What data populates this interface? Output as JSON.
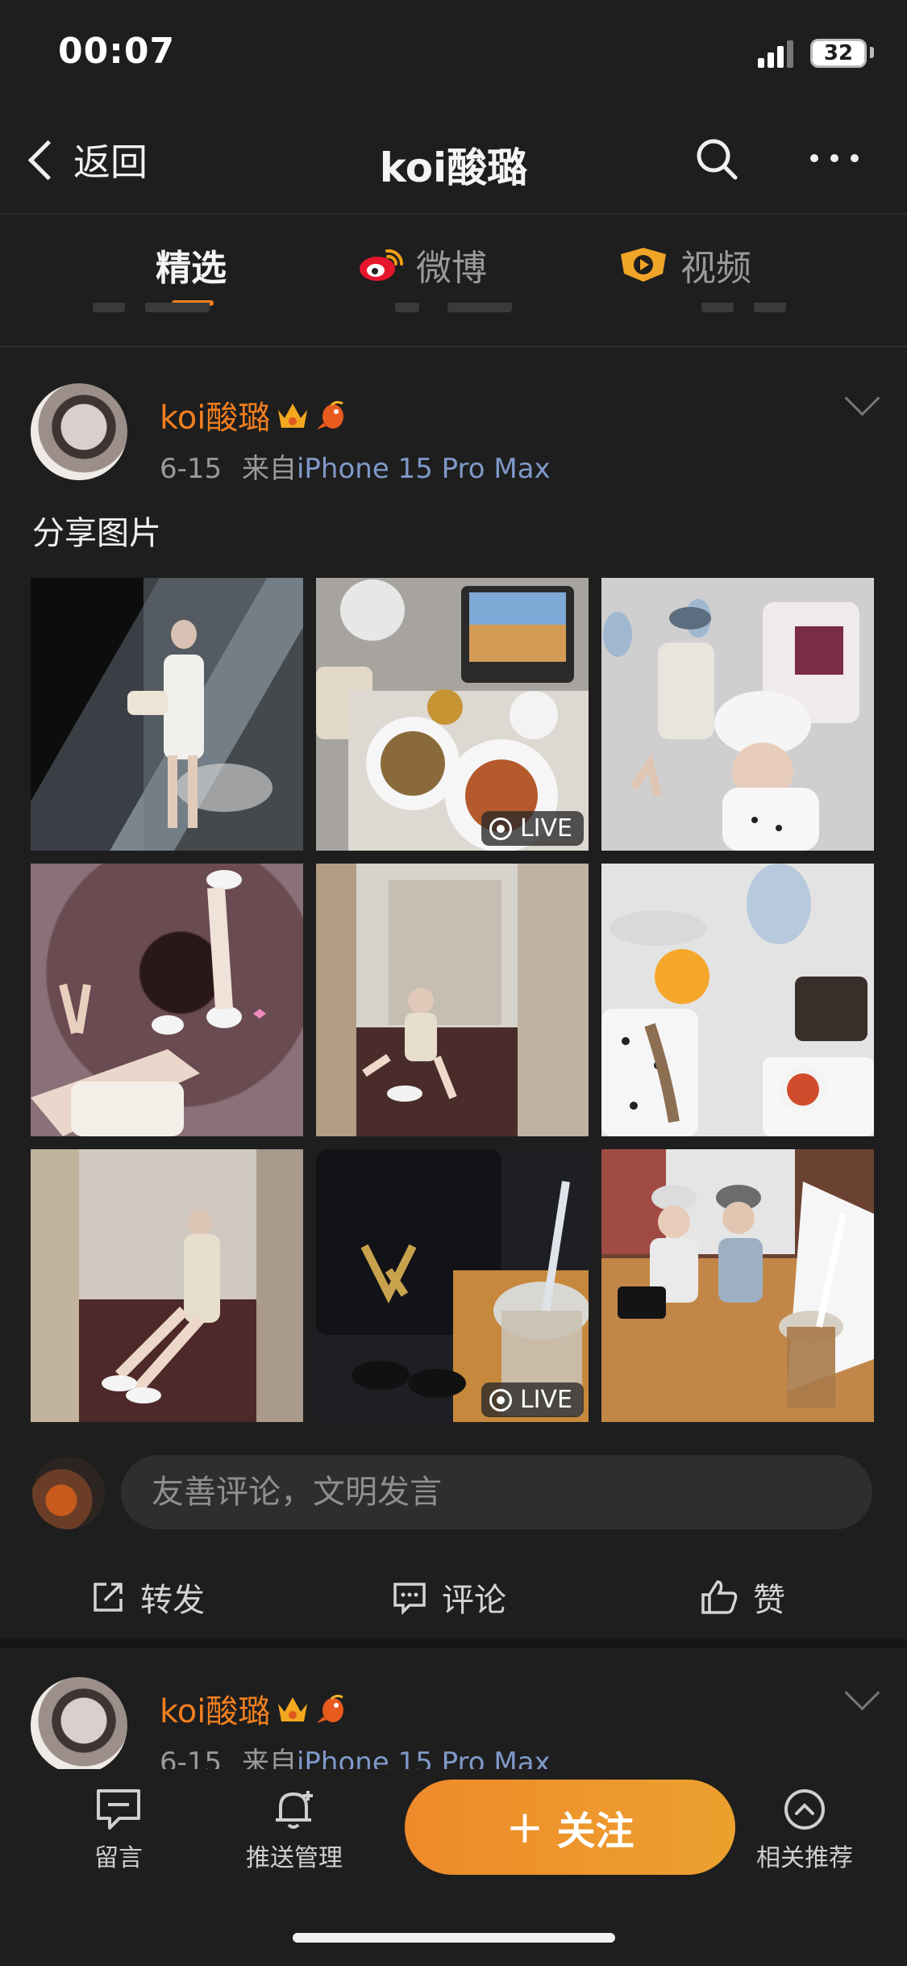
{
  "status": {
    "time": "00:07",
    "battery": "32"
  },
  "nav": {
    "back_label": "返回",
    "title": "koi酸璐"
  },
  "tabs": [
    {
      "label": "精选",
      "icon": ""
    },
    {
      "label": "微博",
      "icon": "weibo-logo-icon"
    },
    {
      "label": "视频",
      "icon": "video-play-icon"
    }
  ],
  "post": {
    "username": "koi酸璐",
    "date": "6-15",
    "source_prefix": "来自",
    "source": "iPhone 15 Pro Max",
    "text": "分享图片",
    "live_label": "LIVE",
    "photos": [
      {
        "desc": "hotel-window",
        "live": false
      },
      {
        "desc": "airline-meal",
        "live": true
      },
      {
        "desc": "airplane-cabin",
        "live": false
      },
      {
        "desc": "floor-selfie",
        "live": false
      },
      {
        "desc": "hallway-sitting",
        "live": false
      },
      {
        "desc": "plane-meal-selfie",
        "live": false
      },
      {
        "desc": "hallway-floor",
        "live": false
      },
      {
        "desc": "bag-drink",
        "live": true
      },
      {
        "desc": "restaurant-friends",
        "live": false
      }
    ]
  },
  "comment": {
    "placeholder": "友善评论，文明发言"
  },
  "actions": {
    "repost": "转发",
    "comment": "评论",
    "like": "赞"
  },
  "next_post": {
    "username": "koi酸璐",
    "date": "6-15",
    "source_prefix": "来自",
    "source": "iPhone 15 Pro Max"
  },
  "bottom_bar": {
    "message": "留言",
    "push": "推送管理",
    "follow": "关注",
    "follow_plus": "+",
    "related": "相关推荐"
  },
  "colors": {
    "accent": "#f07f1f",
    "source_link": "#7f99c9",
    "background": "#1e1e1e"
  }
}
